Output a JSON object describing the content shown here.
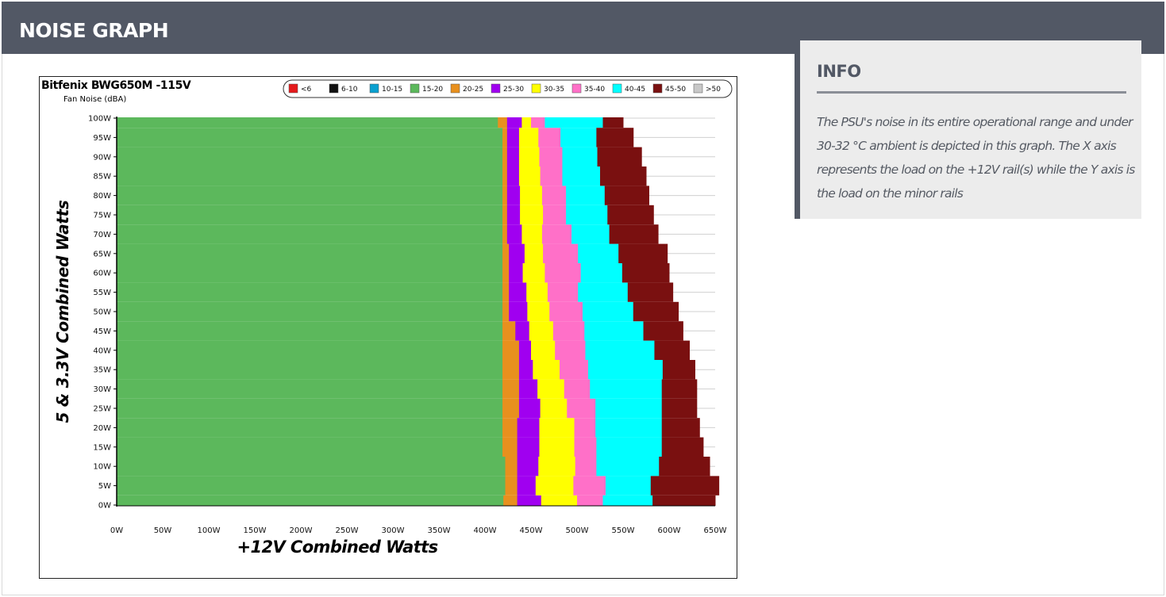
{
  "header": {
    "title": "NOISE GRAPH"
  },
  "info": {
    "title": "INFO",
    "text": "The PSU's noise in its entire operational range and under 30-32 °C ambient is depicted in this graph. The X axis represents the load on the +12V rail(s) while the Y axis is the load on the minor rails"
  },
  "chart_data": {
    "type": "heatmap",
    "title": "Bitfenix BWG650M -115V",
    "subtitle": "Fan Noise (dBA)",
    "xlabel": "+12V Combined Watts",
    "ylabel": "5 & 3.3V Combined Watts",
    "xlim": [
      0,
      650
    ],
    "ylim": [
      0,
      100
    ],
    "x_ticks": [
      "0W",
      "50W",
      "100W",
      "150W",
      "200W",
      "250W",
      "300W",
      "350W",
      "400W",
      "450W",
      "500W",
      "550W",
      "600W",
      "650W"
    ],
    "y_ticks": [
      "0W",
      "5W",
      "10W",
      "15W",
      "20W",
      "25W",
      "30W",
      "35W",
      "40W",
      "45W",
      "50W",
      "55W",
      "60W",
      "65W",
      "70W",
      "75W",
      "80W",
      "85W",
      "90W",
      "95W",
      "100W"
    ],
    "legend_position": "top",
    "legend": [
      {
        "label": "<6",
        "color": "#e41a1c"
      },
      {
        "label": "6-10",
        "color": "#111111"
      },
      {
        "label": "10-15",
        "color": "#0aa0d0"
      },
      {
        "label": "15-20",
        "color": "#5cb85c"
      },
      {
        "label": "20-25",
        "color": "#e8901e"
      },
      {
        "label": "25-30",
        "color": "#a000f0"
      },
      {
        "label": "30-35",
        "color": "#ffff00"
      },
      {
        "label": "35-40",
        "color": "#ff70c8"
      },
      {
        "label": "40-45",
        "color": "#00ffff"
      },
      {
        "label": "45-50",
        "color": "#7a1010"
      },
      {
        "label": ">50",
        "color": "#c8c8c8"
      }
    ],
    "y_rows": [
      0,
      5,
      10,
      15,
      20,
      25,
      30,
      35,
      40,
      45,
      50,
      55,
      60,
      65,
      70,
      75,
      80,
      85,
      90,
      95,
      100
    ],
    "band_upper_bounds_x": {
      "15-20": [
        420,
        422,
        422,
        419,
        419,
        419,
        419,
        419,
        419,
        419,
        419,
        419,
        419,
        419,
        419,
        419,
        419,
        419,
        419,
        419,
        414
      ],
      "20-25": [
        435,
        435,
        435,
        435,
        435,
        437,
        437,
        437,
        437,
        433,
        426,
        426,
        426,
        426,
        424,
        424,
        424,
        424,
        424,
        424,
        424
      ],
      "25-30": [
        461,
        455,
        458,
        459,
        459,
        460,
        457,
        452,
        450,
        448,
        446,
        445,
        441,
        443,
        440,
        438,
        438,
        437,
        437,
        437,
        440
      ],
      "30-35": [
        500,
        496,
        498,
        497,
        497,
        489,
        486,
        481,
        476,
        474,
        470,
        468,
        465,
        463,
        462,
        463,
        462,
        460,
        459,
        458,
        450
      ],
      "35-40": [
        528,
        531,
        521,
        521,
        520,
        520,
        514,
        512,
        509,
        508,
        506,
        501,
        504,
        501,
        494,
        488,
        488,
        484,
        484,
        482,
        465
      ],
      "40-45": [
        582,
        580,
        589,
        592,
        592,
        592,
        592,
        593,
        584,
        572,
        561,
        555,
        549,
        545,
        535,
        533,
        530,
        525,
        522,
        521,
        528
      ],
      "45-50": [
        650,
        654,
        644,
        637,
        633,
        630,
        630,
        628,
        622,
        615,
        610,
        604,
        600,
        598,
        588,
        583,
        578,
        575,
        570,
        561,
        550
      ]
    }
  }
}
